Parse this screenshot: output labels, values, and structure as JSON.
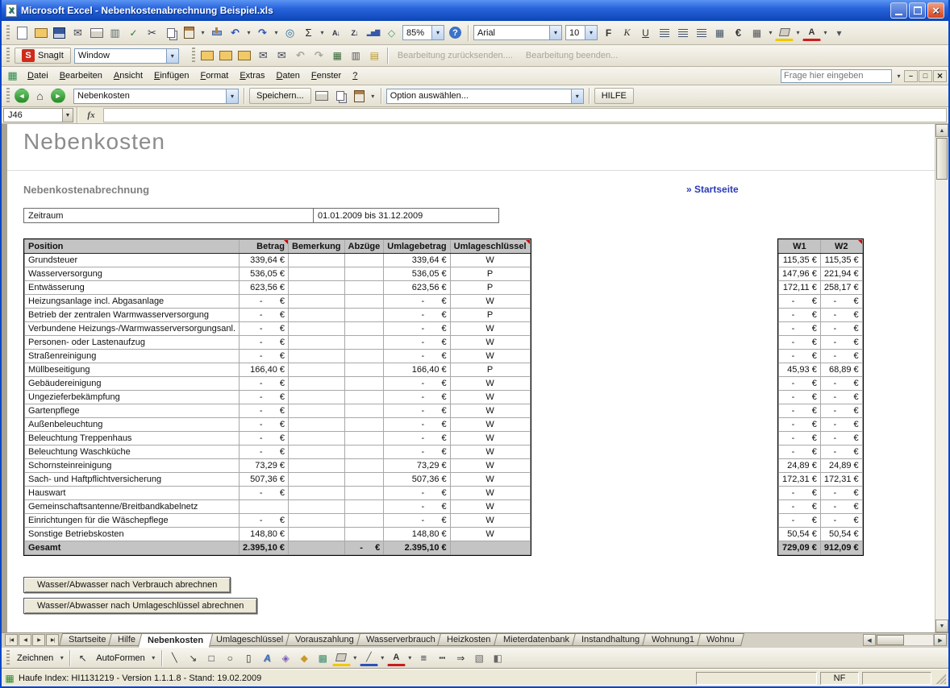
{
  "window": {
    "title": "Microsoft Excel - Nebenkostenabrechnung Beispiel.xls",
    "window_buttons": [
      "minimize-button",
      "restore-button",
      "close-button"
    ]
  },
  "standard_toolbar": {
    "left_icons": [
      "new-icon",
      "open-icon",
      "save-icon",
      "mail-icon",
      "print-icon",
      "print-preview-icon",
      "spelling-icon",
      "cut-icon",
      "copy-icon",
      "paste-icon",
      "format-painter-icon",
      "undo-icon",
      "redo-icon",
      "insert-hyperlink-icon",
      "autosum-icon",
      "sort-asc-icon",
      "sort-desc-icon",
      "chart-wizard-icon",
      "drawing-icon"
    ],
    "zoom_value": "85%",
    "font_name": "Arial",
    "font_size": "10",
    "format_icons": [
      "bold-icon",
      "italic-icon",
      "underline-icon",
      "align-left-icon",
      "align-center-icon",
      "align-right-icon",
      "merge-center-icon",
      "euro-icon",
      "borders-icon",
      "fill-color-icon",
      "font-color-icon",
      "toolbar-options-icon"
    ]
  },
  "snagit_toolbar": {
    "snagit_label": "SnagIt",
    "mode_value": "Window",
    "icons": [
      "folder-open-icon",
      "folder-new-icon",
      "folder-save-icon",
      "mail-reply-icon",
      "mail-forward-icon",
      "review-undo-icon",
      "review-redo-icon",
      "cells-icon",
      "columns-icon",
      "comment-icon"
    ],
    "disabled_labels": [
      "Bearbeitung zurücksenden....",
      "Bearbeitung beenden..."
    ]
  },
  "menu_bar": {
    "items": [
      "Datei",
      "Bearbeiten",
      "Ansicht",
      "Einfügen",
      "Format",
      "Extras",
      "Daten",
      "Fenster",
      "?"
    ],
    "question_placeholder": "Frage hier eingeben",
    "window_buttons": [
      "win-minimize-button",
      "win-restore-button",
      "win-close-button"
    ]
  },
  "custom_toolbar": {
    "nav_icons": [
      "back-icon",
      "home-icon",
      "forward-icon"
    ],
    "sheet_select_value": "Nebenkosten",
    "save_label": "Speichern...",
    "action_icons": [
      "print-small-icon",
      "copy-small-icon",
      "paste-small-icon"
    ],
    "option_select_value": "Option auswählen...",
    "help_label": "HILFE"
  },
  "formula_bar": {
    "name_box_value": "J46",
    "fx_label": "fx"
  },
  "sheet": {
    "page_title": "Nebenkosten",
    "section_title": "Nebenkostenabrechnung",
    "startseite_link": "» Startseite",
    "zeitraum_label": "Zeitraum",
    "zeitraum_value": "01.01.2009 bis 31.12.2009",
    "action_buttons": [
      "Wasser/Abwasser nach Verbrauch abrechnen",
      "Wasser/Abwasser nach Umlageschlüssel abrechnen"
    ]
  },
  "table": {
    "columns": [
      "position",
      "betrag",
      "bemerkung",
      "abzuege",
      "umlagebetrag",
      "umlageschluessel",
      "w1",
      "w2"
    ],
    "main_headers": [
      {
        "label": "Position",
        "comment": false
      },
      {
        "label": "Betrag",
        "comment": true
      },
      {
        "label": "Bemerkung",
        "comment": false
      },
      {
        "label": "Abzüge",
        "comment": false
      },
      {
        "label": "Umlagebetrag",
        "comment": false
      },
      {
        "label": "Umlageschlüssel",
        "comment": true
      }
    ],
    "w_headers": [
      {
        "label": "W1",
        "comment": false
      },
      {
        "label": "W2",
        "comment": true
      }
    ],
    "rows": [
      [
        "Grundsteuer",
        "339,64 €",
        "",
        "",
        "339,64 €",
        "W",
        "115,35 €",
        "115,35 €"
      ],
      [
        "Wasserversorgung",
        "536,05 €",
        "",
        "",
        "536,05 €",
        "P",
        "147,96 €",
        "221,94 €"
      ],
      [
        "Entwässerung",
        "623,56 €",
        "",
        "",
        "623,56 €",
        "P",
        "172,11 €",
        "258,17 €"
      ],
      [
        "Heizungsanlage incl. Abgasanlage",
        "-       €",
        "",
        "",
        "-       €",
        "W",
        "-       €",
        "-       €"
      ],
      [
        "Betrieb der zentralen Warmwasserversorgung",
        "-       €",
        "",
        "",
        "-       €",
        "P",
        "-       €",
        "-       €"
      ],
      [
        "Verbundene Heizungs-/Warmwasserversorgungsanl.",
        "-       €",
        "",
        "",
        "-       €",
        "W",
        "-       €",
        "-       €"
      ],
      [
        "Personen- oder Lastenaufzug",
        "-       €",
        "",
        "",
        "-       €",
        "W",
        "-       €",
        "-       €"
      ],
      [
        "Straßenreinigung",
        "-       €",
        "",
        "",
        "-       €",
        "W",
        "-       €",
        "-       €"
      ],
      [
        "Müllbeseitigung",
        "166,40 €",
        "",
        "",
        "166,40 €",
        "P",
        "45,93 €",
        "68,89 €"
      ],
      [
        "Gebäudereinigung",
        "-       €",
        "",
        "",
        "-       €",
        "W",
        "-       €",
        "-       €"
      ],
      [
        "Ungezieferbekämpfung",
        "-       €",
        "",
        "",
        "-       €",
        "W",
        "-       €",
        "-       €"
      ],
      [
        "Gartenpflege",
        "-       €",
        "",
        "",
        "-       €",
        "W",
        "-       €",
        "-       €"
      ],
      [
        "Außenbeleuchtung",
        "-       €",
        "",
        "",
        "-       €",
        "W",
        "-       €",
        "-       €"
      ],
      [
        "Beleuchtung Treppenhaus",
        "-       €",
        "",
        "",
        "-       €",
        "W",
        "-       €",
        "-       €"
      ],
      [
        "Beleuchtung Waschküche",
        "-       €",
        "",
        "",
        "-       €",
        "W",
        "-       €",
        "-       €"
      ],
      [
        "Schornsteinreinigung",
        "73,29 €",
        "",
        "",
        "73,29 €",
        "W",
        "24,89 €",
        "24,89 €"
      ],
      [
        "Sach- und Haftpflichtversicherung",
        "507,36 €",
        "",
        "",
        "507,36 €",
        "W",
        "172,31 €",
        "172,31 €"
      ],
      [
        "Hauswart",
        "-       €",
        "",
        "",
        "-       €",
        "W",
        "-       €",
        "-       €"
      ],
      [
        "Gemeinschaftsantenne/Breitbandkabelnetz",
        "",
        "",
        "",
        "-       €",
        "W",
        "-       €",
        "-       €"
      ],
      [
        "Einrichtungen für die Wäschepflege",
        "-       €",
        "",
        "",
        "-       €",
        "W",
        "-       €",
        "-       €"
      ],
      [
        "Sonstige Betriebskosten",
        "148,80 €",
        "",
        "",
        "148,80 €",
        "W",
        "50,54 €",
        "50,54 €"
      ]
    ],
    "total_row": [
      "Gesamt",
      "2.395,10 €",
      "",
      "-     €",
      "2.395,10 €",
      "",
      "729,09 €",
      "912,09 €"
    ]
  },
  "sheet_tabs": {
    "nav": [
      "first-tab-button",
      "prev-tab-button",
      "next-tab-button",
      "last-tab-button"
    ],
    "tabs": [
      "Startseite",
      "Hilfe",
      "Nebenkosten",
      "Umlageschlüssel",
      "Vorauszahlung",
      "Wasserverbrauch",
      "Heizkosten",
      "Mieterdatenbank",
      "Instandhaltung",
      "Wohnung1",
      "Wohnu"
    ],
    "active": "Nebenkosten"
  },
  "drawing_toolbar": {
    "zeichnen_label": "Zeichnen",
    "autoformen_label": "AutoFormen",
    "icons": [
      "select-arrow-icon",
      "line-icon",
      "arrow-icon",
      "rectangle-icon",
      "oval-icon",
      "textbox-icon",
      "wordart-icon",
      "diagram-icon",
      "clipart-icon",
      "picture-icon",
      "fill-color2-icon",
      "line-color-icon",
      "font-color2-icon",
      "line-style-icon",
      "dash-style-icon",
      "arrow-style-icon",
      "shadow-style-icon",
      "threed-style-icon"
    ]
  },
  "status_bar": {
    "left_text": "Haufe Index: HI1131219 - Version 1.1.1.8 - Stand: 19.02.2009",
    "right_text": "NF"
  }
}
